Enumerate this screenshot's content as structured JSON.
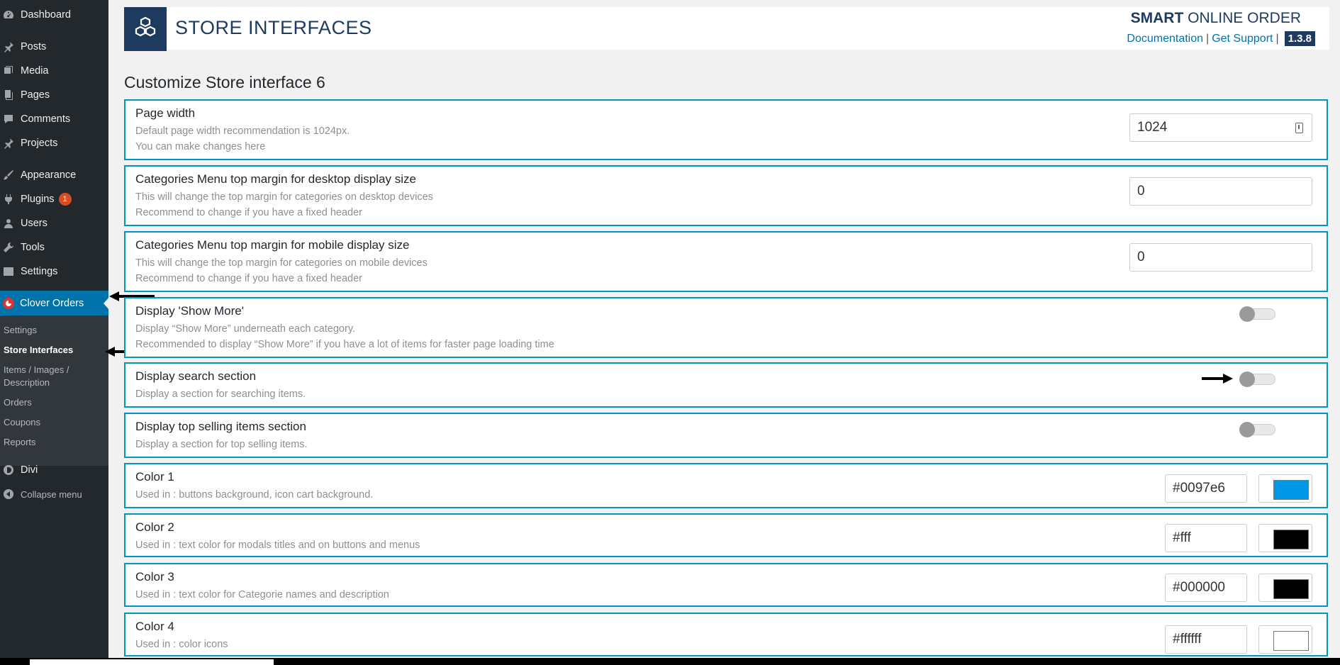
{
  "sidebar": {
    "items": [
      {
        "label": "Dashboard",
        "icon": "dashboard-icon"
      },
      {
        "label": "Posts",
        "icon": "pin-icon"
      },
      {
        "label": "Media",
        "icon": "media-icon"
      },
      {
        "label": "Pages",
        "icon": "pages-icon"
      },
      {
        "label": "Comments",
        "icon": "comment-icon"
      },
      {
        "label": "Projects",
        "icon": "pin-icon"
      },
      {
        "label": "Appearance",
        "icon": "brush-icon"
      },
      {
        "label": "Plugins",
        "icon": "plug-icon",
        "badge": "1"
      },
      {
        "label": "Users",
        "icon": "user-icon"
      },
      {
        "label": "Tools",
        "icon": "wrench-icon"
      },
      {
        "label": "Settings",
        "icon": "settings-icon"
      },
      {
        "label": "Clover Orders",
        "icon": "clover-icon",
        "active": true
      },
      {
        "label": "Divi",
        "icon": "divi-icon"
      },
      {
        "label": "Collapse menu",
        "icon": "collapse-icon"
      }
    ],
    "submenu": [
      {
        "label": "Settings"
      },
      {
        "label": "Store Interfaces",
        "current": true
      },
      {
        "label": "Items / Images / Description"
      },
      {
        "label": "Orders"
      },
      {
        "label": "Coupons"
      },
      {
        "label": "Reports"
      }
    ]
  },
  "header": {
    "title": "STORE INTERFACES",
    "brand_bold": "SMART",
    "brand_rest": " ONLINE ORDER",
    "doc_link": "Documentation",
    "separator": "|",
    "support_link": "Get Support",
    "version": "1.3.8",
    "logo_icon": "cubes-icon"
  },
  "section_heading": "Customize Store interface 6",
  "settings": [
    {
      "title": "Page width",
      "desc": [
        "Default page width recommendation is 1024px.",
        "You can make changes here"
      ],
      "control": "number",
      "value": "1024"
    },
    {
      "title": "Categories Menu top margin for desktop display size",
      "desc": [
        "This will change the top margin for categories on desktop devices",
        "Recommend to change if you have a fixed header"
      ],
      "control": "number",
      "value": "0"
    },
    {
      "title": "Categories Menu top margin for mobile display size",
      "desc": [
        "This will change the top margin for categories on mobile devices",
        "Recommend to change if you have a fixed header"
      ],
      "control": "number",
      "value": "0"
    },
    {
      "title": "Display 'Show More'",
      "desc": [
        "Display “Show More” underneath each category.",
        "Recommended to display “Show More” if you have a lot of items for faster page loading time"
      ],
      "control": "toggle",
      "on": false
    },
    {
      "title": "Display search section",
      "desc": [
        "Display a section for searching items."
      ],
      "control": "toggle",
      "on": false
    },
    {
      "title": "Display top selling items section",
      "desc": [
        "Display a section for top selling items."
      ],
      "control": "toggle",
      "on": false
    },
    {
      "title": "Color 1",
      "desc": [
        "Used in : buttons background, icon cart background."
      ],
      "control": "color",
      "value": "#0097e6",
      "swatch": "#0097e6"
    },
    {
      "title": "Color 2",
      "desc": [
        "Used in : text color for modals titles and on buttons and menus"
      ],
      "control": "color",
      "value": "#fff",
      "swatch": "#000000"
    },
    {
      "title": "Color 3",
      "desc": [
        "Used in : text color for Categorie names and description"
      ],
      "control": "color",
      "value": "#000000",
      "swatch": "#000000"
    },
    {
      "title": "Color 4",
      "desc": [
        "Used in : color icons"
      ],
      "control": "color",
      "value": "#ffffff",
      "swatch": "#ffffff"
    }
  ],
  "colors": {
    "sidebar_bg": "#23282d",
    "active_bg": "#0073aa",
    "card_border": "#0097bd",
    "brand_navy": "#1e3a5f"
  }
}
